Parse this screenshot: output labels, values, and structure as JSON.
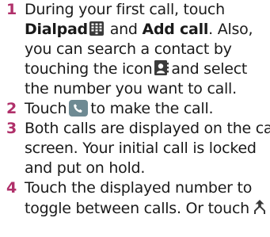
{
  "colors": {
    "step_number": "#b0306a",
    "icon_dark": "#3a3a3a",
    "call_button_bg": "#6e8a93"
  },
  "steps": [
    {
      "number": "1",
      "line1": "During your first call, touch",
      "dialpad_label": "Dialpad",
      "and_text": "and",
      "add_call_label": "Add call",
      "also_text": ". Also,",
      "line3": "you can search a contact by",
      "line4_before_icon": "touching the icon",
      "line4_after_icon": "and select",
      "line5": "the number you want to call.",
      "icons": [
        "dialpad-icon",
        "contact-icon"
      ]
    },
    {
      "number": "2",
      "before_icon": "Touch",
      "after_icon": "to make the call.",
      "icons": [
        "call-icon"
      ]
    },
    {
      "number": "3",
      "line1": "Both calls are displayed on the call",
      "line2": "screen. Your initial call is locked",
      "line3": "and put on hold."
    },
    {
      "number": "4",
      "line1": "Touch the displayed number to",
      "line2_before_icon": "toggle between calls. Or touch",
      "icons": [
        "merge-icon"
      ]
    }
  ]
}
